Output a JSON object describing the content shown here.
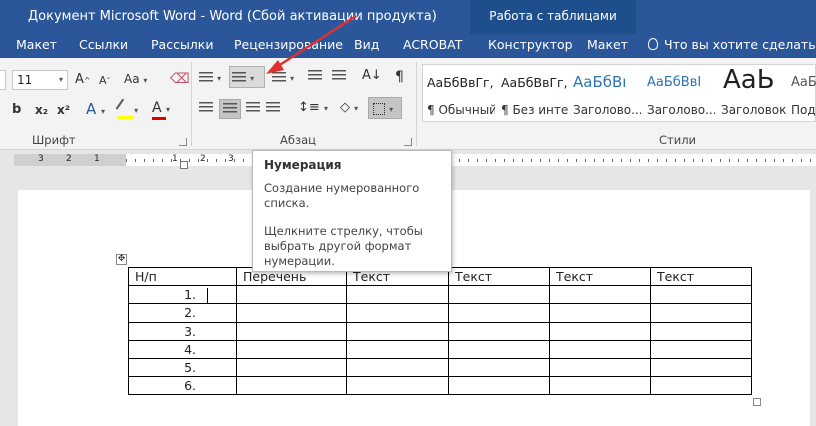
{
  "window": {
    "title": "Документ Microsoft Word - Word (Сбой активации продукта)"
  },
  "contextual": {
    "title": "Работа с таблицами"
  },
  "tabs": [
    {
      "label": "Макет"
    },
    {
      "label": "Ссылки"
    },
    {
      "label": "Рассылки"
    },
    {
      "label": "Рецензирование"
    },
    {
      "label": "Вид"
    },
    {
      "label": "ACROBAT"
    },
    {
      "label": "Конструктор"
    },
    {
      "label": "Макет"
    }
  ],
  "tell_me": {
    "text": "Что вы хотите сделать?"
  },
  "ribbon": {
    "font": {
      "group_label": "Шрифт",
      "size_value": "11",
      "bold_label": "b",
      "subscript_label": "x₂",
      "superscript_label": "x²",
      "grow_label": "A",
      "shrink_label": "A",
      "effects_label": "A",
      "font_color_label": "A",
      "case_label": "Aa",
      "dd": "▾",
      "colors": {
        "highlight": "#ffff00",
        "font_color": "#e00000",
        "effects": "#2b579a"
      }
    },
    "paragraph": {
      "group_label": "Абзац",
      "sort_icon": "sort-icon",
      "pilcrow_label": "¶",
      "dd": "▾"
    },
    "styles": {
      "group_label": "Стили",
      "items": [
        {
          "sample": "АаБбВвГг,",
          "name": "¶ Обычный"
        },
        {
          "sample": "АаБбВвГг,",
          "name": "¶ Без инте..."
        },
        {
          "sample": "АаБбВı",
          "name": "Заголово..."
        },
        {
          "sample": "АаБбВвI",
          "name": "Заголово..."
        },
        {
          "sample": "АаЬ",
          "name": "Заголовок"
        },
        {
          "sample": "АаБб",
          "name": "Подза"
        }
      ]
    }
  },
  "ruler": {
    "marks": [
      "3",
      "2",
      "1",
      "1",
      "2",
      "3"
    ]
  },
  "tooltip": {
    "title": "Нумерация",
    "lines": [
      "Создание нумерованного",
      "списка.",
      "Щелкните стрелку, чтобы",
      "выбрать другой формат",
      "нумерации."
    ]
  },
  "table": {
    "header": [
      "Н/п",
      "Перечень",
      "Текст",
      "Текст",
      "Текст",
      "Текст"
    ],
    "rows": [
      "1.",
      "2.",
      "3.",
      "4.",
      "5.",
      "6."
    ]
  },
  "annotation": {
    "arrow_color": "#e03030"
  }
}
